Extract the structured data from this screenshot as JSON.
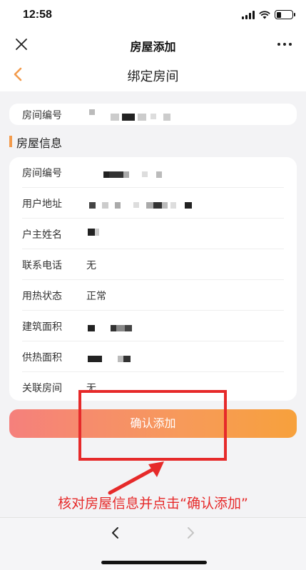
{
  "status_bar": {
    "time": "12:58",
    "battery_level": 0.3
  },
  "top_nav": {
    "title": "房屋添加",
    "close_icon": "close-icon",
    "more_icon": "more-icon"
  },
  "page": {
    "title": "绑定房间",
    "back_icon": "chevron-left-icon"
  },
  "room_number_card": {
    "label": "房间编号"
  },
  "section": {
    "title": "房屋信息"
  },
  "info": {
    "rows": [
      {
        "label": "房间编号",
        "value": ""
      },
      {
        "label": "用户地址",
        "value": ""
      },
      {
        "label": "户主姓名",
        "value": ""
      },
      {
        "label": "联系电话",
        "value": "无"
      },
      {
        "label": "用热状态",
        "value": "正常"
      },
      {
        "label": "建筑面积",
        "value": ""
      },
      {
        "label": "供热面积",
        "value": ""
      },
      {
        "label": "关联房间",
        "value": "无"
      }
    ]
  },
  "confirm_button": {
    "label": "确认添加"
  },
  "annotation": {
    "text": "核对房屋信息并点击“确认添加”",
    "color": "#e62a2a"
  },
  "browser_nav": {
    "back_icon": "chevron-left-icon",
    "forward_icon": "chevron-right-icon"
  },
  "colors": {
    "accent": "#f39b4c",
    "button_start": "#f5807c",
    "button_end": "#f7a13c"
  }
}
